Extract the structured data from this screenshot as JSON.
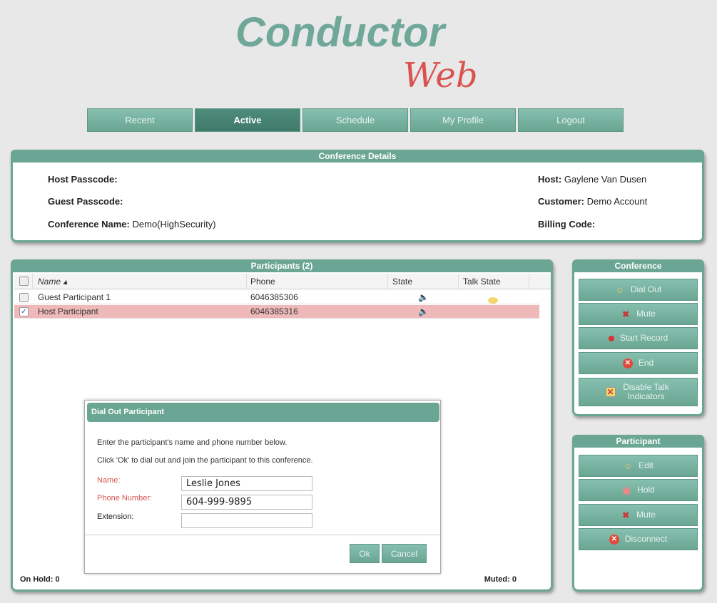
{
  "logo": {
    "main": "Conductor",
    "sub": "Web"
  },
  "nav": [
    {
      "label": "Recent"
    },
    {
      "label": "Active"
    },
    {
      "label": "Schedule"
    },
    {
      "label": "My Profile"
    },
    {
      "label": "Logout"
    }
  ],
  "details": {
    "title": "Conference Details",
    "host_passcode_label": "Host Passcode:",
    "host_passcode": "",
    "guest_passcode_label": "Guest Passcode:",
    "guest_passcode": "",
    "conference_name_label": "Conference Name:",
    "conference_name": "Demo(HighSecurity)",
    "host_label": "Host:",
    "host": "Gaylene Van Dusen",
    "customer_label": "Customer:",
    "customer": "Demo Account",
    "billing_label": "Billing Code:",
    "billing": ""
  },
  "participants": {
    "title": "Participants (2)",
    "columns": {
      "name": "Name ▴",
      "phone": "Phone",
      "state": "State",
      "talk_state": "Talk State"
    },
    "rows": [
      {
        "name": "Guest Participant 1",
        "phone": "6046385306",
        "checked": false,
        "talking": true
      },
      {
        "name": "Host Participant",
        "phone": "6046385316",
        "checked": true,
        "talking": false
      }
    ],
    "on_hold": "On Hold: 0",
    "muted": "Muted: 0"
  },
  "conference_panel": {
    "title": "Conference",
    "buttons": [
      "Dial Out",
      "Mute",
      "Start Record",
      "End",
      "Disable Talk Indicators"
    ]
  },
  "participant_panel": {
    "title": "Participant",
    "buttons": [
      "Edit",
      "Hold",
      "Mute",
      "Disconnect"
    ]
  },
  "dialog": {
    "title": "Dial Out Participant",
    "line1": "Enter the participant's name and phone number below.",
    "line2": "Click 'Ok' to dial out and join the participant to this conference.",
    "name_label": "Name:",
    "name_value": "Leslie Jones",
    "phone_label": "Phone Number:",
    "phone_value": "604-999-9895",
    "ext_label": "Extension:",
    "ext_value": "",
    "ok": "Ok",
    "cancel": "Cancel"
  }
}
